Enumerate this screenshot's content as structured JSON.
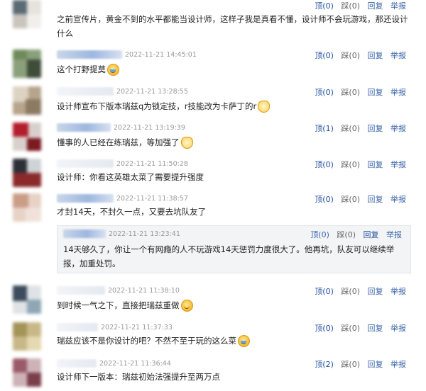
{
  "comments": [
    {
      "time": "",
      "actions": {
        "up": "",
        "down": "",
        "reply": "",
        "report": ""
      },
      "lines": [
        "之前宣传片，黄金不到的水平都能当设计师，这样子我是真看不懂，设计师不会玩游戏，那还设计",
        "什么"
      ]
    },
    {
      "time": "2022-11-21 14:45:01",
      "actions": {
        "up": "顶(0)",
        "down": "踩(0)",
        "reply": "回复",
        "report": "举报"
      },
      "text": "这个打野提莫"
    },
    {
      "time": "2022-11-21 13:28:55",
      "actions": {
        "up": "顶(0)",
        "down": "踩(0)",
        "reply": "回复",
        "report": "举报"
      },
      "text": "设计师宣布下版本瑞兹q为锁定技，r技能改为卡萨丁的r"
    },
    {
      "time": "2022-11-21 13:19:39",
      "actions": {
        "up": "顶(1)",
        "down": "踩(0)",
        "reply": "回复",
        "report": "举报"
      },
      "text": "懂事的人已经在练瑞兹，等加强了"
    },
    {
      "time": "2022-11-21 11:50:28",
      "actions": {
        "up": "顶(0)",
        "down": "踩(0)",
        "reply": "回复",
        "report": "举报"
      },
      "text": "设计师：你看这英雄太菜了需要提升强度"
    },
    {
      "time": "2022-11-21 11:38:57",
      "actions": {
        "up": "顶(0)",
        "down": "踩(0)",
        "reply": "回复",
        "report": "举报"
      },
      "text": "才封14天，不封久一点，又要去坑队友了"
    },
    {
      "time": "2022-11-21 13:23:41",
      "actions": {
        "up": "顶(0)",
        "down": "踩(0)",
        "reply": "回复",
        "report": "举报"
      },
      "lines": [
        "14天够久了，你让一个有网瘾的人不玩游戏14天惩罚力度很大了。他再坑，队友可以继续举",
        "报，加重处罚。"
      ]
    },
    {
      "time": "2022-11-21 11:38:10",
      "actions": {
        "up": "顶(0)",
        "down": "踩(0)",
        "reply": "回复",
        "report": "举报"
      },
      "text": "到时候一气之下，直接把瑞兹重做"
    },
    {
      "time": "2022-11-21 11:37:33",
      "actions": {
        "up": "顶(0)",
        "down": "踩(0)",
        "reply": "回复",
        "report": "举报"
      },
      "text": "瑞兹应该不是你设计的吧？不然不至于玩的这么菜"
    },
    {
      "time": "2022-11-21 11:36:44",
      "actions": {
        "up": "顶(2)",
        "down": "踩(0)",
        "reply": "回复",
        "report": "举报"
      },
      "text": "设计师下一版本：瑞兹初始法强提升至两万点"
    }
  ],
  "top_actions": {
    "up": "顶(0)",
    "down": "踩(0)",
    "reply": "回复",
    "report": "举报"
  }
}
